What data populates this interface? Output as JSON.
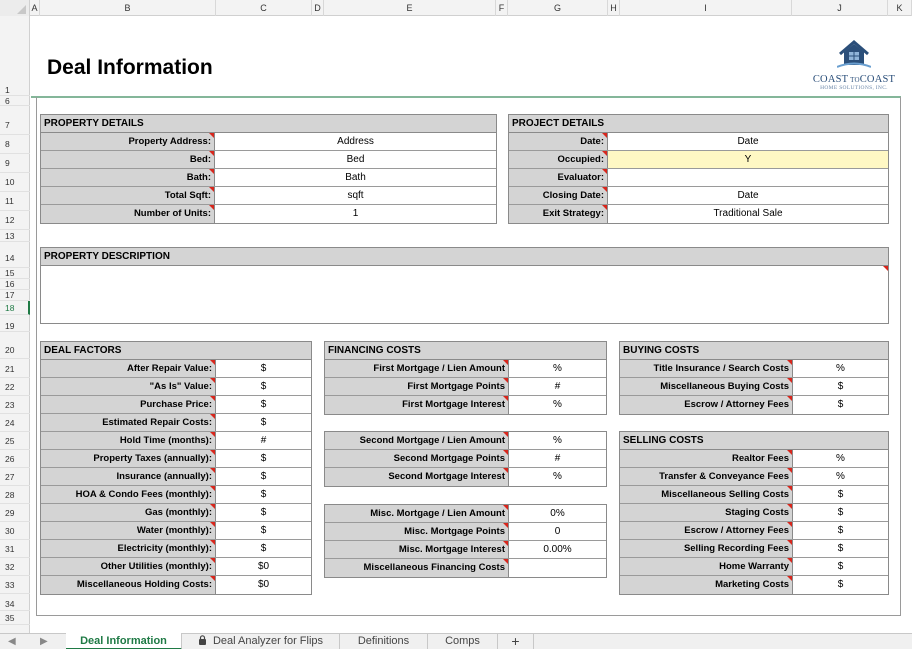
{
  "columns": [
    "A",
    "B",
    "C",
    "D",
    "E",
    "F",
    "G",
    "H",
    "I",
    "J",
    "K"
  ],
  "rows": [
    "1",
    "6",
    "7",
    "8",
    "9",
    "10",
    "11",
    "12",
    "13",
    "14",
    "15",
    "16",
    "17",
    "18",
    "19",
    "20",
    "21",
    "22",
    "23",
    "24",
    "25",
    "26",
    "27",
    "28",
    "29",
    "30",
    "31",
    "32",
    "33",
    "34",
    "35"
  ],
  "title": "Deal Information",
  "logo": {
    "line1": "COAST",
    "line1b": "TO",
    "line1c": "COAST",
    "line2": "HOME SOLUTIONS, INC."
  },
  "property_details": {
    "header": "PROPERTY DETAILS",
    "rows": [
      {
        "label": "Property Address:",
        "value": "Address"
      },
      {
        "label": "Bed:",
        "value": "Bed"
      },
      {
        "label": "Bath:",
        "value": "Bath"
      },
      {
        "label": "Total Sqft:",
        "value": "sqft"
      },
      {
        "label": "Number of Units:",
        "value": "1"
      }
    ]
  },
  "project_details": {
    "header": "PROJECT DETAILS",
    "rows": [
      {
        "label": "Date:",
        "value": "Date"
      },
      {
        "label": "Occupied:",
        "value": "Y"
      },
      {
        "label": "Evaluator:",
        "value": ""
      },
      {
        "label": "Closing Date:",
        "value": "Date"
      },
      {
        "label": "Exit Strategy:",
        "value": "Traditional Sale"
      }
    ]
  },
  "property_description": {
    "header": "PROPERTY DESCRIPTION"
  },
  "deal_factors": {
    "header": "DEAL FACTORS",
    "rows": [
      {
        "label": "After Repair Value:",
        "value": "$"
      },
      {
        "label": "\"As Is\" Value:",
        "value": "$"
      },
      {
        "label": "Purchase Price:",
        "value": "$"
      },
      {
        "label": "Estimated Repair Costs:",
        "value": "$"
      },
      {
        "label": "Hold Time (months):",
        "value": "#"
      },
      {
        "label": "Property Taxes (annually):",
        "value": "$"
      },
      {
        "label": "Insurance (annually):",
        "value": "$"
      },
      {
        "label": "HOA & Condo Fees (monthly):",
        "value": "$"
      },
      {
        "label": "Gas (monthly):",
        "value": "$"
      },
      {
        "label": "Water (monthly):",
        "value": "$"
      },
      {
        "label": "Electricity (monthly):",
        "value": "$"
      },
      {
        "label": "Other Utilities (monthly):",
        "value": "$0"
      },
      {
        "label": "Miscellaneous Holding Costs:",
        "value": "$0"
      }
    ]
  },
  "financing_costs": {
    "header": "FINANCING COSTS",
    "group1": [
      {
        "label": "First Mortgage / Lien Amount",
        "value": "%"
      },
      {
        "label": "First Mortgage Points",
        "value": "#"
      },
      {
        "label": "First Mortgage Interest",
        "value": "%"
      }
    ],
    "group2": [
      {
        "label": "Second Mortgage / Lien Amount",
        "value": "%"
      },
      {
        "label": "Second Mortgage Points",
        "value": "#"
      },
      {
        "label": "Second Mortgage Interest",
        "value": "%"
      }
    ],
    "group3": [
      {
        "label": "Misc. Mortgage / Lien Amount",
        "value": "0%"
      },
      {
        "label": "Misc. Mortgage Points",
        "value": "0"
      },
      {
        "label": "Misc. Mortgage Interest",
        "value": "0.00%"
      },
      {
        "label": "Miscellaneous Financing Costs",
        "value": ""
      }
    ]
  },
  "buying_costs": {
    "header": "BUYING COSTS",
    "rows": [
      {
        "label": "Title Insurance / Search Costs",
        "value": "%"
      },
      {
        "label": "Miscellaneous Buying Costs",
        "value": "$"
      },
      {
        "label": "Escrow / Attorney Fees",
        "value": "$"
      }
    ]
  },
  "selling_costs": {
    "header": "SELLING COSTS",
    "rows": [
      {
        "label": "Realtor Fees",
        "value": "%"
      },
      {
        "label": "Transfer & Conveyance Fees",
        "value": "%"
      },
      {
        "label": "Miscellaneous Selling Costs",
        "value": "$"
      },
      {
        "label": "Staging Costs",
        "value": "$"
      },
      {
        "label": "Escrow / Attorney Fees",
        "value": "$"
      },
      {
        "label": "Selling Recording Fees",
        "value": "$"
      },
      {
        "label": "Home Warranty",
        "value": "$"
      },
      {
        "label": "Marketing Costs",
        "value": "$"
      }
    ]
  },
  "tabs": [
    "Deal Information",
    "Deal Analyzer for Flips",
    "Definitions",
    "Comps"
  ],
  "tab_nav": {
    "prev": "◀",
    "next": "▶",
    "add": "+"
  },
  "colors": {
    "accent": "#1f7a45",
    "header_fill": "#d4d4d4",
    "highlight": "#fff8c4",
    "comment_marker": "#d8261c"
  }
}
